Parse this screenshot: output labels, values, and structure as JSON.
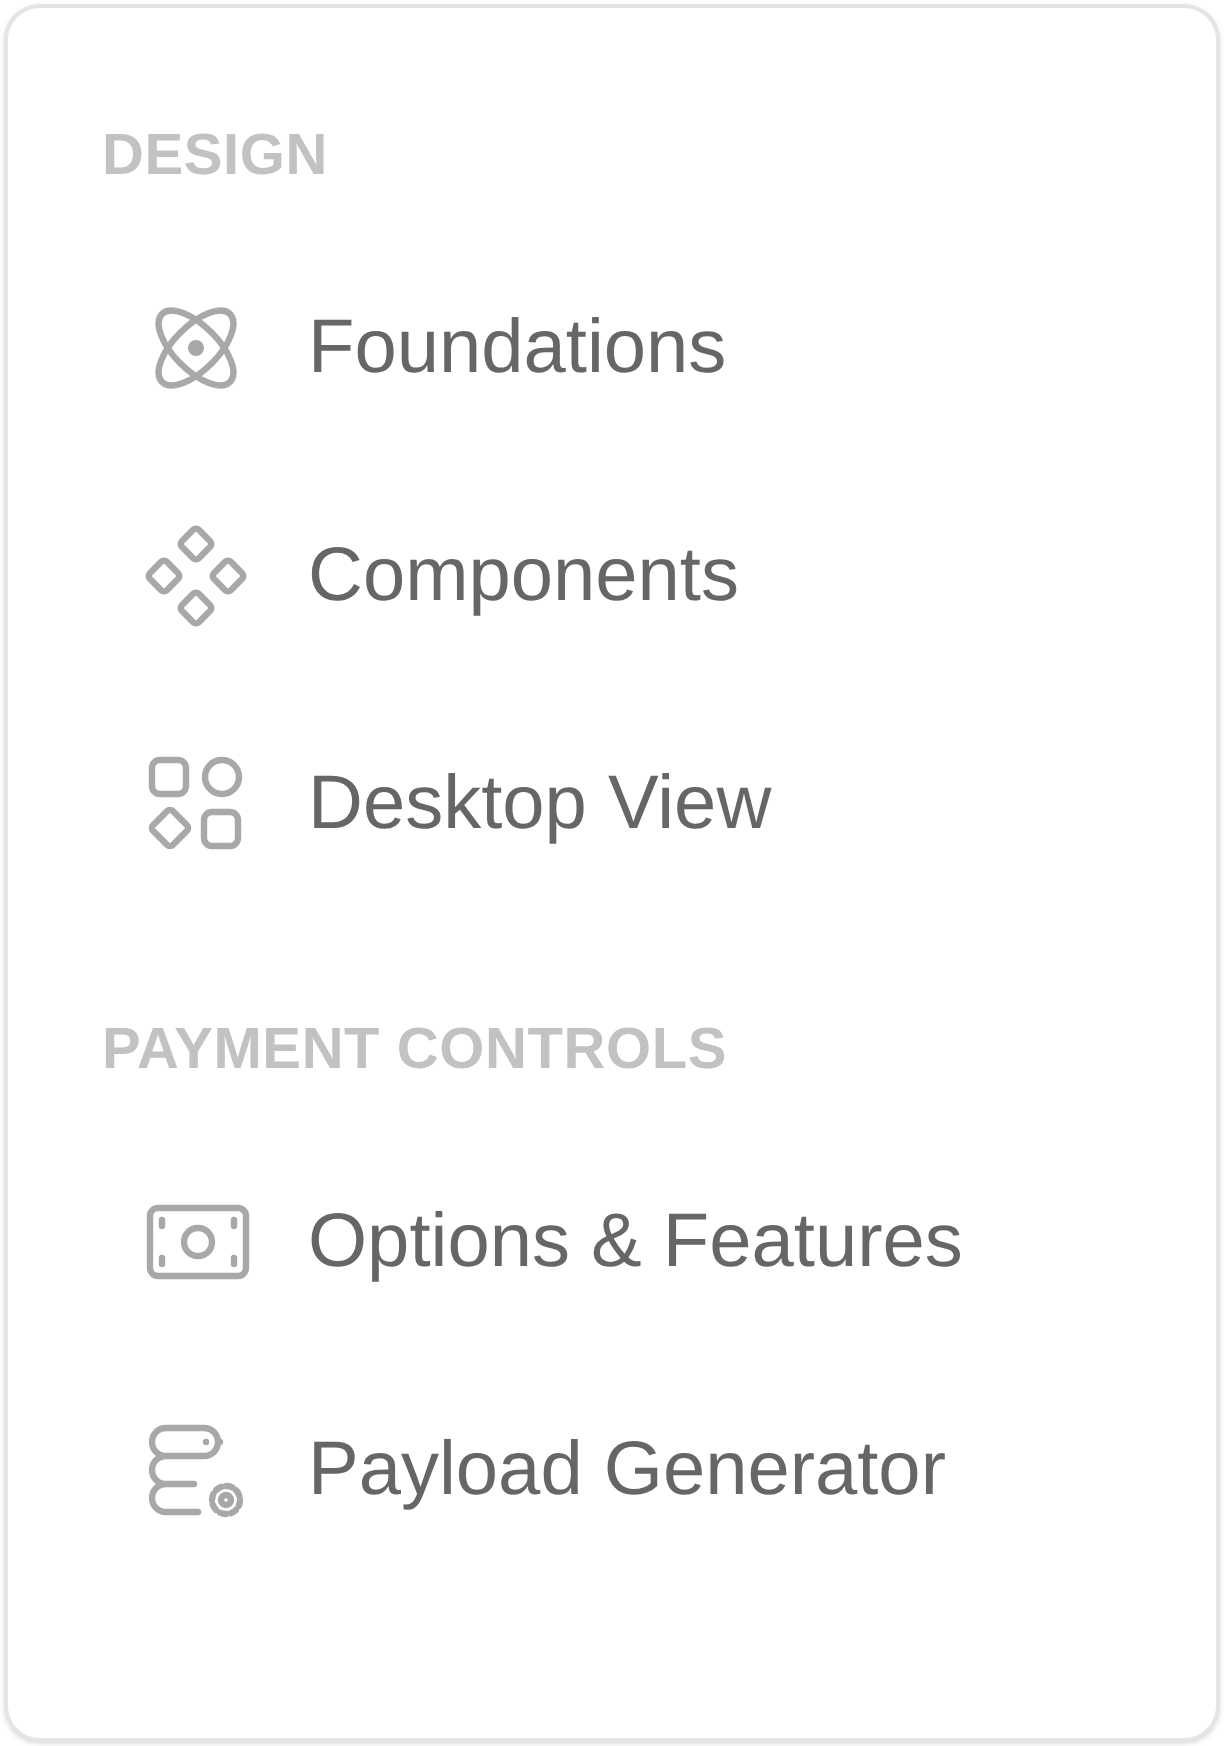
{
  "sections": [
    {
      "heading": "DESIGN",
      "items": [
        {
          "label": "Foundations"
        },
        {
          "label": "Components"
        },
        {
          "label": "Desktop View"
        }
      ]
    },
    {
      "heading": "PAYMENT CONTROLS",
      "items": [
        {
          "label": "Options & Features"
        },
        {
          "label": "Payload Generator"
        }
      ]
    }
  ]
}
